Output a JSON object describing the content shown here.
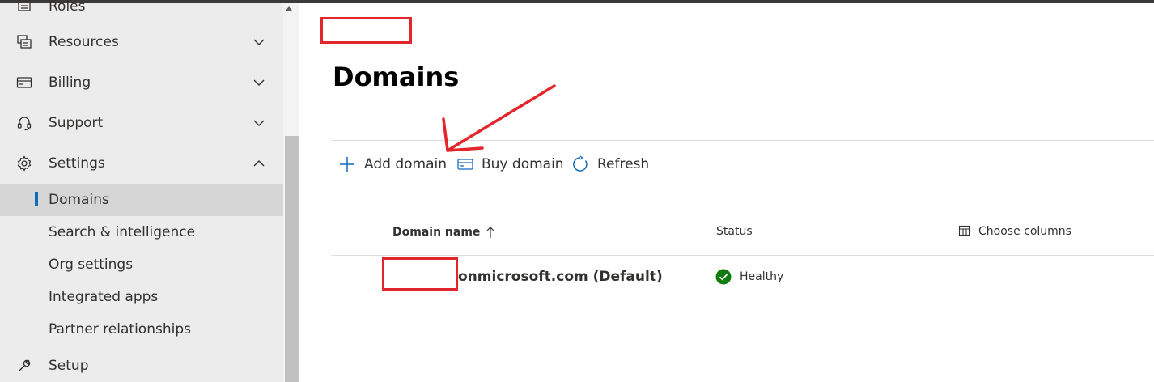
{
  "sidebar": {
    "items": [
      {
        "label": "Roles",
        "icon": "roles-icon"
      },
      {
        "label": "Resources",
        "icon": "resources-icon",
        "expanded": false
      },
      {
        "label": "Billing",
        "icon": "billing-icon",
        "expanded": false
      },
      {
        "label": "Support",
        "icon": "headset-icon",
        "expanded": false
      },
      {
        "label": "Settings",
        "icon": "gear-icon",
        "expanded": true
      },
      {
        "label": "Setup",
        "icon": "wrench-icon"
      }
    ],
    "settings_children": [
      "Domains",
      "Search & intelligence",
      "Org settings",
      "Integrated apps",
      "Partner relationships"
    ],
    "selected": "Domains"
  },
  "main": {
    "title": "Domains",
    "commands": {
      "add": "Add domain",
      "buy": "Buy domain",
      "refresh": "Refresh"
    },
    "table": {
      "columns": {
        "domain_name": "Domain name",
        "status": "Status",
        "choose_columns": "Choose columns"
      },
      "rows": [
        {
          "domain": "onmicrosoft.com (Default)",
          "status": "Healthy"
        }
      ]
    }
  },
  "colors": {
    "accent": "#0f6cbd",
    "healthy": "#107c10",
    "annotation": "#e3262b"
  }
}
